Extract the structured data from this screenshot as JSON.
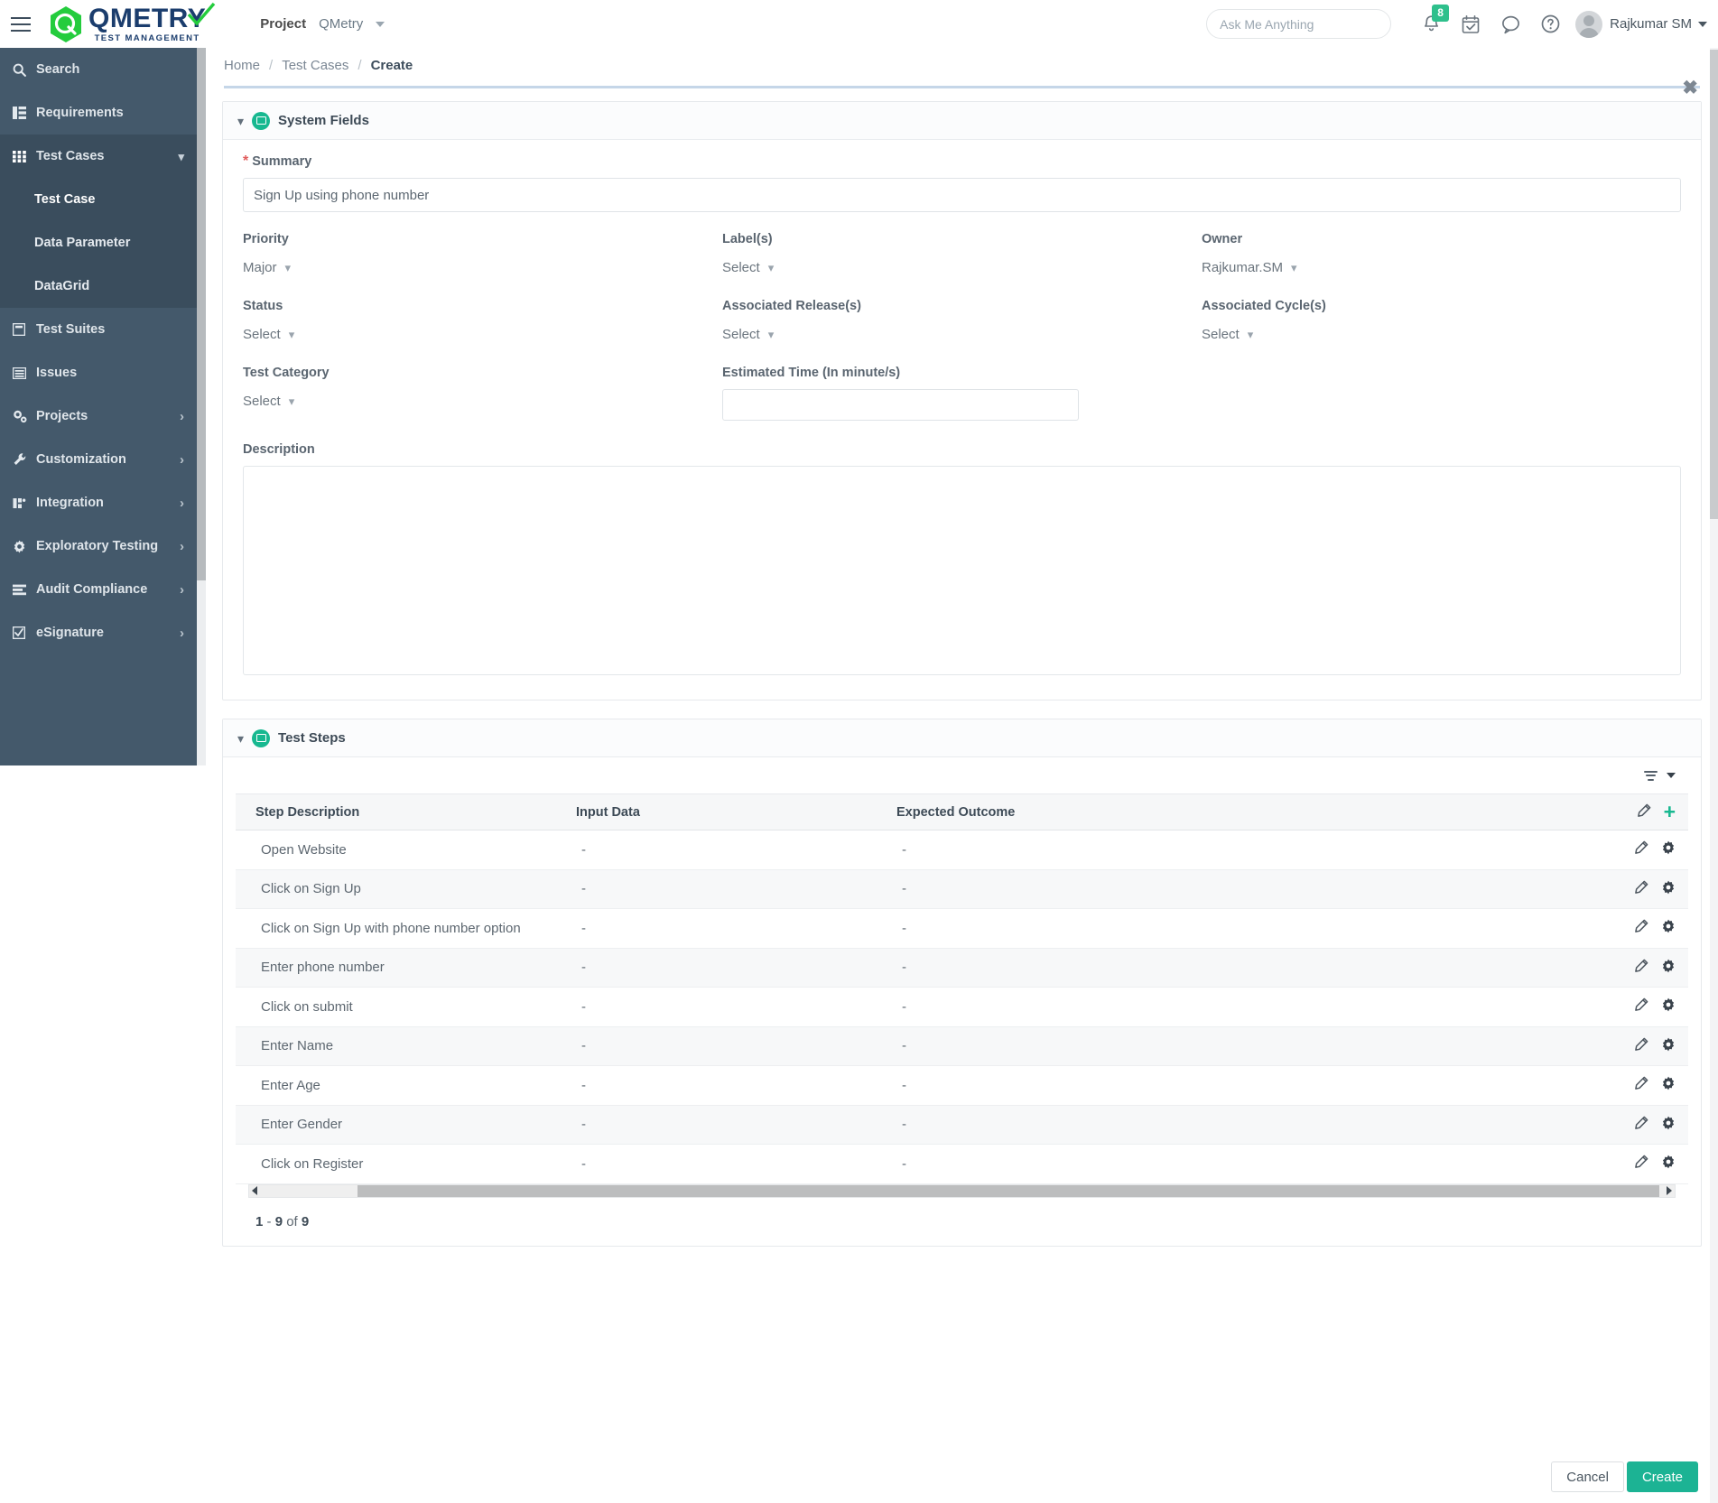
{
  "topbar": {
    "menu_icon": "hamburger-icon",
    "brand_name": "QMETRY",
    "brand_tagline": "TEST MANAGEMENT",
    "project_label": "Project",
    "project_value": "QMetry",
    "search_placeholder": "Ask Me Anything",
    "search_value": "",
    "notification_count": "8",
    "icons": [
      "bell-icon",
      "calendar-check-icon",
      "chat-icon",
      "help-icon"
    ],
    "username": "Rajkumar SM"
  },
  "sidebar": {
    "items": [
      {
        "label": "Search",
        "icon": "search-icon",
        "expandable": false
      },
      {
        "label": "Requirements",
        "icon": "requirements-icon",
        "expandable": false
      },
      {
        "label": "Test Cases",
        "icon": "test-cases-icon",
        "expandable": true,
        "expanded": true
      },
      {
        "label": "Test Suites",
        "icon": "test-suites-icon",
        "expandable": false
      },
      {
        "label": "Issues",
        "icon": "issues-icon",
        "expandable": false
      },
      {
        "label": "Projects",
        "icon": "projects-icon",
        "expandable": true
      },
      {
        "label": "Customization",
        "icon": "wrench-icon",
        "expandable": true
      },
      {
        "label": "Integration",
        "icon": "integration-icon",
        "expandable": true
      },
      {
        "label": "Exploratory Testing",
        "icon": "gear-icon",
        "expandable": true
      },
      {
        "label": "Audit Compliance",
        "icon": "audit-icon",
        "expandable": true
      },
      {
        "label": "eSignature",
        "icon": "esignature-icon",
        "expandable": true
      }
    ],
    "subitems": [
      {
        "label": "Test Case",
        "selected": true
      },
      {
        "label": "Data Parameter",
        "selected": false
      },
      {
        "label": "DataGrid",
        "selected": false
      }
    ]
  },
  "breadcrumb": {
    "home": "Home",
    "section": "Test Cases",
    "current": "Create",
    "separator": "/"
  },
  "system_fields": {
    "title": "System Fields",
    "icon": "monitor-icon",
    "summary_label": "Summary",
    "summary_value": "Sign Up using phone number",
    "summary_placeholder": "Summary",
    "priority_label": "Priority",
    "priority_value": "Major",
    "labels_label": "Label(s)",
    "labels_value": "Select",
    "owner_label": "Owner",
    "owner_value": "Rajkumar.SM",
    "status_label": "Status",
    "status_value": "Select",
    "release_label": "Associated Release(s)",
    "release_value": "Select",
    "cycle_label": "Associated Cycle(s)",
    "cycle_value": "Select",
    "category_label": "Test Category",
    "category_value": "Select",
    "estimated_label": "Estimated Time (In minute/s)",
    "estimated_value": "",
    "description_label": "Description",
    "description_value": ""
  },
  "test_steps": {
    "title": "Test Steps",
    "icon": "monitor-icon",
    "columns": [
      "Step Description",
      "Input Data",
      "Expected Outcome"
    ],
    "rows": [
      {
        "step": "Open Website",
        "input": "-",
        "outcome": "-"
      },
      {
        "step": "Click on Sign Up",
        "input": "-",
        "outcome": "-"
      },
      {
        "step": "Click on Sign Up with phone number option",
        "input": "-",
        "outcome": "-"
      },
      {
        "step": "Enter phone number",
        "input": "-",
        "outcome": "-"
      },
      {
        "step": "Click on submit",
        "input": "-",
        "outcome": "-"
      },
      {
        "step": "Enter Name",
        "input": "-",
        "outcome": "-"
      },
      {
        "step": "Enter Age",
        "input": "-",
        "outcome": "-"
      },
      {
        "step": "Enter Gender",
        "input": "-",
        "outcome": "-"
      },
      {
        "step": "Click on Register",
        "input": "-",
        "outcome": "-"
      }
    ],
    "pager_from": "1",
    "pager_dash": "-",
    "pager_to": "9",
    "pager_of": "of",
    "pager_total": "9"
  },
  "footer": {
    "cancel_label": "Cancel",
    "create_label": "Create"
  },
  "colors": {
    "accent_green": "#17b890",
    "brand_blue": "#1b3d6d",
    "sidebar_bg": "#44596b",
    "sidebar_active": "#3a4d5d",
    "required_red": "#e05c5c"
  }
}
